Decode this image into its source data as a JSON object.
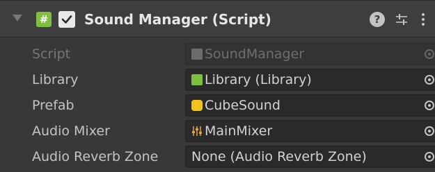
{
  "header": {
    "title": "Sound Manager (Script)",
    "enabled_checked": true,
    "fold_icon": "triangle-down-icon",
    "script_icon": "csharp-script-icon",
    "script_icon_glyph": "#",
    "help_icon": "help-icon",
    "help_glyph": "?",
    "presets_icon": "presets-icon",
    "menu_icon": "kebab-menu-icon"
  },
  "fields": [
    {
      "label": "Script",
      "value": "SoundManager",
      "icon": "csharp-script-icon",
      "icon_color": "#6c6c6c",
      "disabled": true
    },
    {
      "label": "Library",
      "value": "Library (Library)",
      "icon": "csharp-script-icon",
      "icon_color": "#7fbf3f",
      "disabled": false
    },
    {
      "label": "Prefab",
      "value": "CubeSound",
      "icon": "prefab-icon",
      "icon_color": "#f2c31a",
      "disabled": false
    },
    {
      "label": "Audio Mixer",
      "value": "MainMixer",
      "icon": "audio-mixer-icon",
      "icon_color": "#e8a33d",
      "disabled": false
    },
    {
      "label": "Audio Reverb Zone",
      "value": "None (Audio Reverb Zone)",
      "icon": "",
      "icon_color": "",
      "disabled": false
    }
  ],
  "colors": {
    "background": "#383838",
    "header_background": "#3e3e3e",
    "field_background": "#2a2a2a",
    "text": "#c4c4c4"
  }
}
